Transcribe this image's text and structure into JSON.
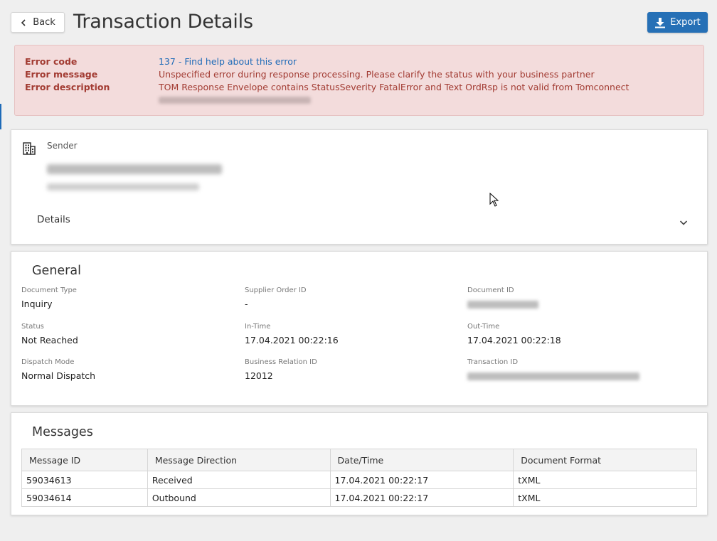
{
  "header": {
    "back_label": "Back",
    "title": "Transaction Details",
    "export_label": "Export"
  },
  "error": {
    "code_label": "Error code",
    "code_value": "137 - Find help about this error",
    "message_label": "Error message",
    "message_value": "Unspecified error during response processing. Please clarify the status with your business partner",
    "description_label": "Error description",
    "description_value": "TOM Response Envelope contains StatusSeverity FatalError and Text OrdRsp is not valid from Tomconnect"
  },
  "sender": {
    "label": "Sender",
    "details_label": "Details"
  },
  "general": {
    "title": "General",
    "fields": [
      {
        "label": "Document Type",
        "value": "Inquiry"
      },
      {
        "label": "Supplier Order ID",
        "value": "-"
      },
      {
        "label": "Document ID",
        "value": ""
      },
      {
        "label": "Status",
        "value": "Not Reached"
      },
      {
        "label": "In-Time",
        "value": "17.04.2021 00:22:16"
      },
      {
        "label": "Out-Time",
        "value": "17.04.2021 00:22:18"
      },
      {
        "label": "Dispatch Mode",
        "value": "Normal Dispatch"
      },
      {
        "label": "Business Relation ID",
        "value": "12012"
      },
      {
        "label": "Transaction ID",
        "value": ""
      }
    ]
  },
  "messages": {
    "title": "Messages",
    "columns": [
      "Message ID",
      "Message Direction",
      "Date/Time",
      "Document Format"
    ],
    "rows": [
      [
        "59034613",
        "Received",
        "17.04.2021 00:22:17",
        "tXML"
      ],
      [
        "59034614",
        "Outbound",
        "17.04.2021 00:22:17",
        "tXML"
      ]
    ]
  },
  "colors": {
    "accent": "#2670b6",
    "error_bg": "#f3dcdc",
    "error_text": "#a23b32",
    "link": "#1e6bb8"
  },
  "icons": {
    "back": "chevron-left-icon",
    "export": "download-icon",
    "sender": "building-icon",
    "details": "chevron-down-icon"
  }
}
